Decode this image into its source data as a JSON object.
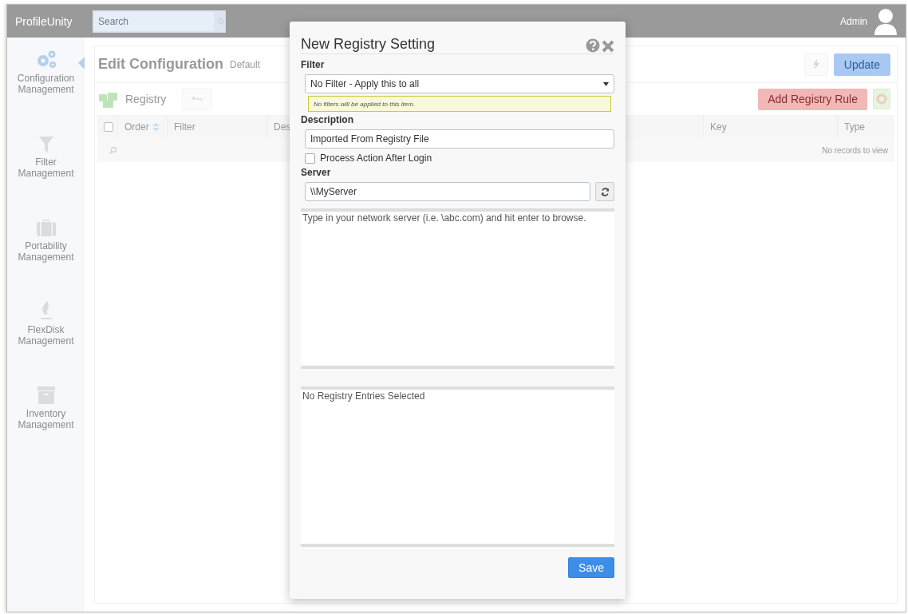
{
  "header": {
    "logo": "ProfileUnity",
    "search": {
      "placeholder": "Search"
    },
    "user": "Admin"
  },
  "sidebar": {
    "items": [
      {
        "kind": "gears",
        "label": "Configuration Management",
        "selected": true
      },
      {
        "kind": "funnel",
        "label": "Filter Management",
        "selected": false
      },
      {
        "kind": "suitcase",
        "label": "Portability Management",
        "selected": false
      },
      {
        "kind": "flame",
        "label": "FlexDisk Management",
        "selected": false
      },
      {
        "kind": "archive",
        "label": "Inventory Management",
        "selected": false
      }
    ]
  },
  "page": {
    "title": "Edit Configuration",
    "subtitle": "Default",
    "update_button": "Update",
    "section": "Registry",
    "add_button": "Add Registry Rule",
    "table": {
      "select_all": {
        "checked": false
      },
      "columns": [
        {
          "label": "Order",
          "sortable": true
        },
        {
          "label": "Filter",
          "sortable": false
        },
        {
          "label": "Des"
        },
        {
          "label": "Key",
          "sortable": false
        },
        {
          "label": "Type",
          "sortable": false
        }
      ],
      "empty_message": "No records to view"
    }
  },
  "dialog": {
    "title": "New Registry Setting",
    "filter": {
      "label": "Filter",
      "value": "No Filter - Apply this to all",
      "hint": "No filters will be applied to this item."
    },
    "description": {
      "label": "Description",
      "value": "Imported From Registry File"
    },
    "process_after_login": {
      "label": "Process Action After Login",
      "checked": false
    },
    "server": {
      "label": "Server",
      "value": "\\\\MyServer"
    },
    "browse_text": "Type in your network server (i.e. \\abc.com) and hit enter to browse.",
    "entries_text": "No Registry Entries Selected",
    "save_button": "Save"
  }
}
